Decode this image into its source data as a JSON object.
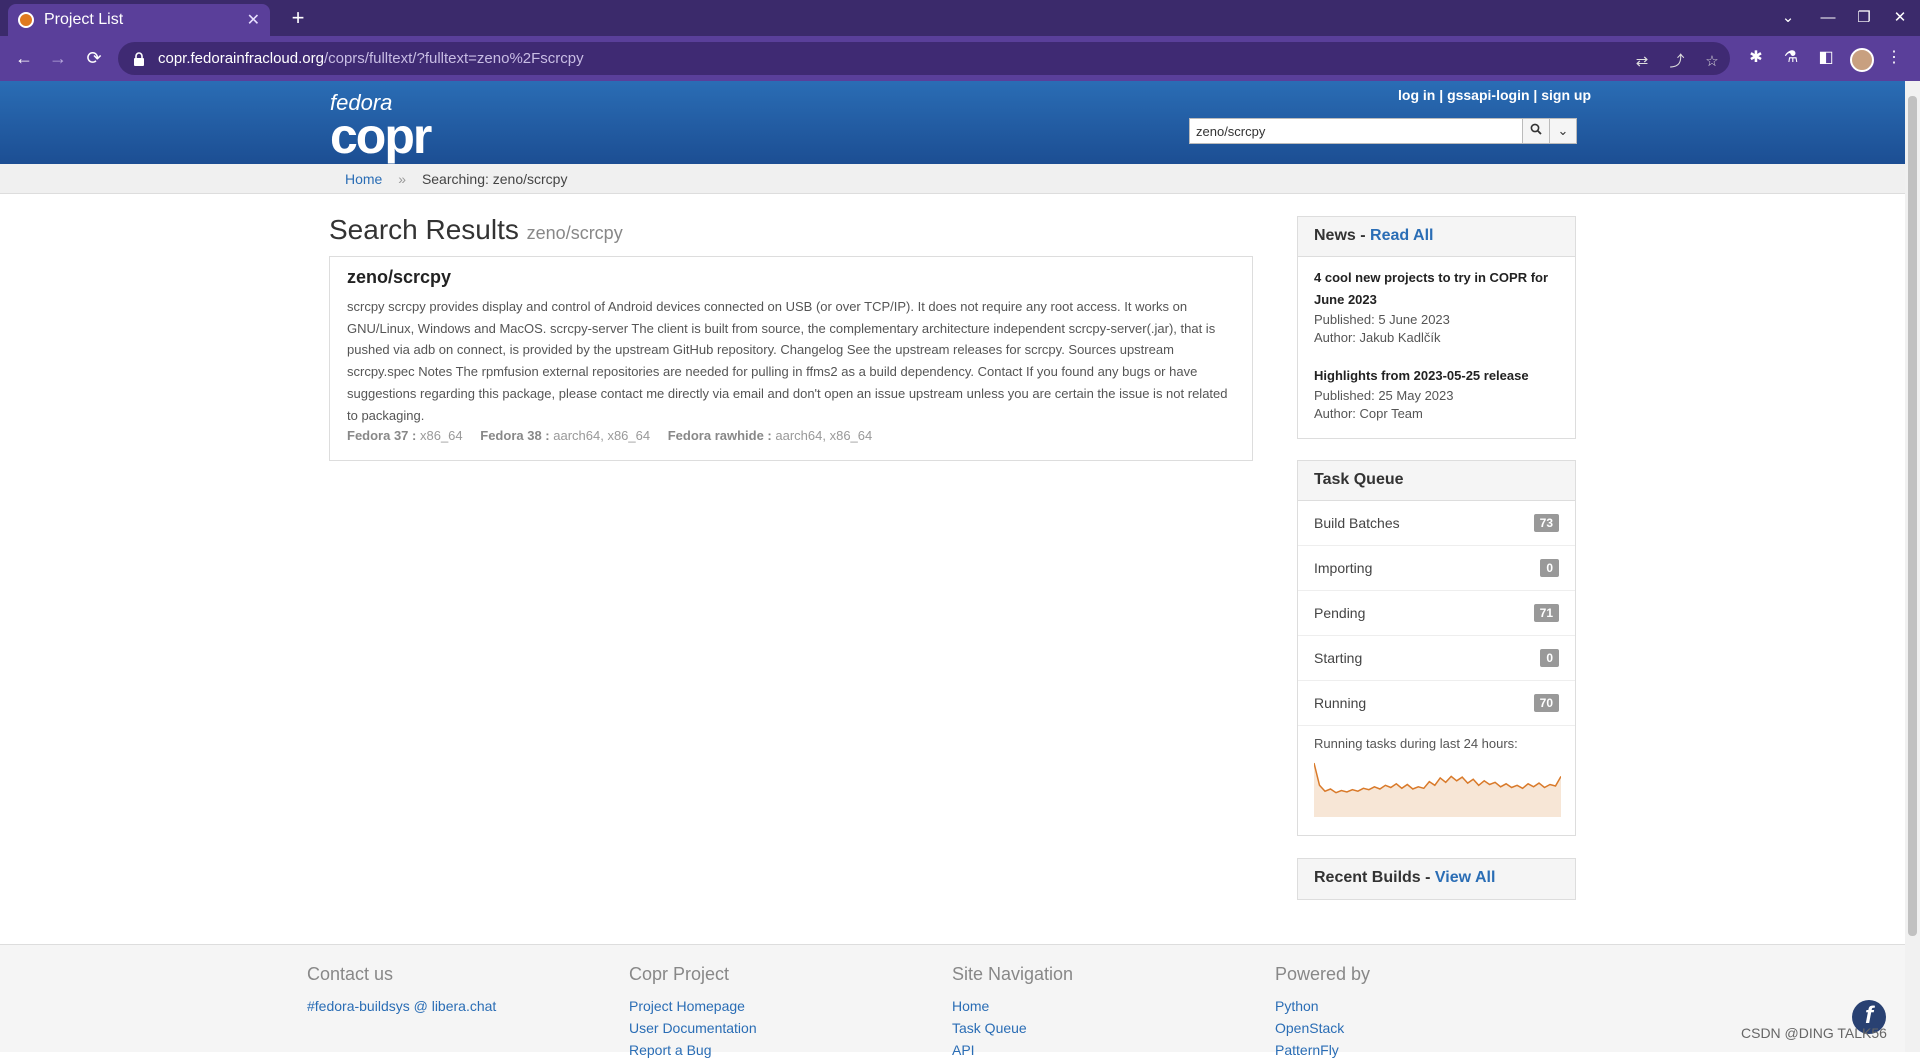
{
  "browser": {
    "tab_title": "Project List",
    "url_host": "copr.fedorainfracloud.org",
    "url_path": "/coprs/fulltext/?fulltext=zeno%2Fscrcpy"
  },
  "header": {
    "logo_top": "fedora",
    "logo_bottom": "copr",
    "login": "log in",
    "gssapi": "gssapi-login",
    "signup": "sign up",
    "sep": "|",
    "search_value": "zeno/scrcpy"
  },
  "breadcrumb": {
    "home": "Home",
    "sep": "»",
    "current": "Searching: zeno/scrcpy"
  },
  "main": {
    "title": "Search Results",
    "subtitle": "zeno/scrcpy",
    "result": {
      "name": "zeno/scrcpy",
      "description": "scrcpy scrcpy provides display and control of Android devices connected on USB (or over TCP/IP). It does not require any root access. It works on GNU/Linux, Windows and MacOS. scrcpy-server The client is built from source, the complementary architecture independent scrcpy-server(.jar), that is pushed via adb on connect, is provided by the upstream GitHub repository. Changelog See the upstream releases for scrcpy. Sources upstream scrcpy.spec Notes The rpmfusion external repositories are needed for pulling in ffms2 as a build dependency. Contact If you found any bugs or have suggestions regarding this package, please contact me directly via email and don't open an issue upstream unless you are certain the issue is not related to packaging.",
      "chroots": [
        {
          "name": "Fedora 37 :",
          "arches": "x86_64"
        },
        {
          "name": "Fedora 38 :",
          "arches": "aarch64, x86_64"
        },
        {
          "name": "Fedora rawhide :",
          "arches": "aarch64, x86_64"
        }
      ]
    }
  },
  "news": {
    "heading": "News -",
    "read_all": "Read All",
    "items": [
      {
        "title": "4 cool new projects to try in COPR for June 2023",
        "published": "Published: 5 June 2023",
        "author": "Author: Jakub Kadlčík"
      },
      {
        "title": "Highlights from 2023-05-25 release",
        "published": "Published: 25 May 2023",
        "author": "Author: Copr Team"
      }
    ]
  },
  "task_queue": {
    "heading": "Task Queue",
    "rows": [
      {
        "label": "Build Batches",
        "count": "73"
      },
      {
        "label": "Importing",
        "count": "0"
      },
      {
        "label": "Pending",
        "count": "71"
      },
      {
        "label": "Starting",
        "count": "0"
      },
      {
        "label": "Running",
        "count": "70"
      }
    ],
    "spark_label": "Running tasks during last 24 hours:",
    "spark_values": [
      70,
      40,
      32,
      35,
      30,
      33,
      31,
      34,
      32,
      36,
      34,
      38,
      35,
      40,
      37,
      42,
      36,
      41,
      35,
      38,
      36,
      45,
      40,
      50,
      44,
      52,
      46,
      51,
      43,
      48,
      40,
      46,
      41,
      44,
      38,
      42,
      37,
      40,
      36,
      42,
      38,
      43,
      37,
      41,
      39,
      52
    ]
  },
  "recent_builds": {
    "heading": "Recent Builds -",
    "view_all": "View All"
  },
  "footer": {
    "contact": {
      "heading": "Contact us",
      "links": [
        "#fedora-buildsys @ libera.chat"
      ]
    },
    "project": {
      "heading": "Copr Project",
      "links": [
        "Project Homepage",
        "User Documentation",
        "Report a Bug"
      ]
    },
    "nav": {
      "heading": "Site Navigation",
      "links": [
        "Home",
        "Task Queue",
        "API"
      ]
    },
    "powered": {
      "heading": "Powered by",
      "links": [
        "Python",
        "OpenStack",
        "PatternFly"
      ]
    }
  },
  "watermark": "CSDN @DING TALK56",
  "colors": {
    "header": "#2a6db5",
    "browser": "#5a3f9a",
    "spark": "#d97a2a"
  }
}
